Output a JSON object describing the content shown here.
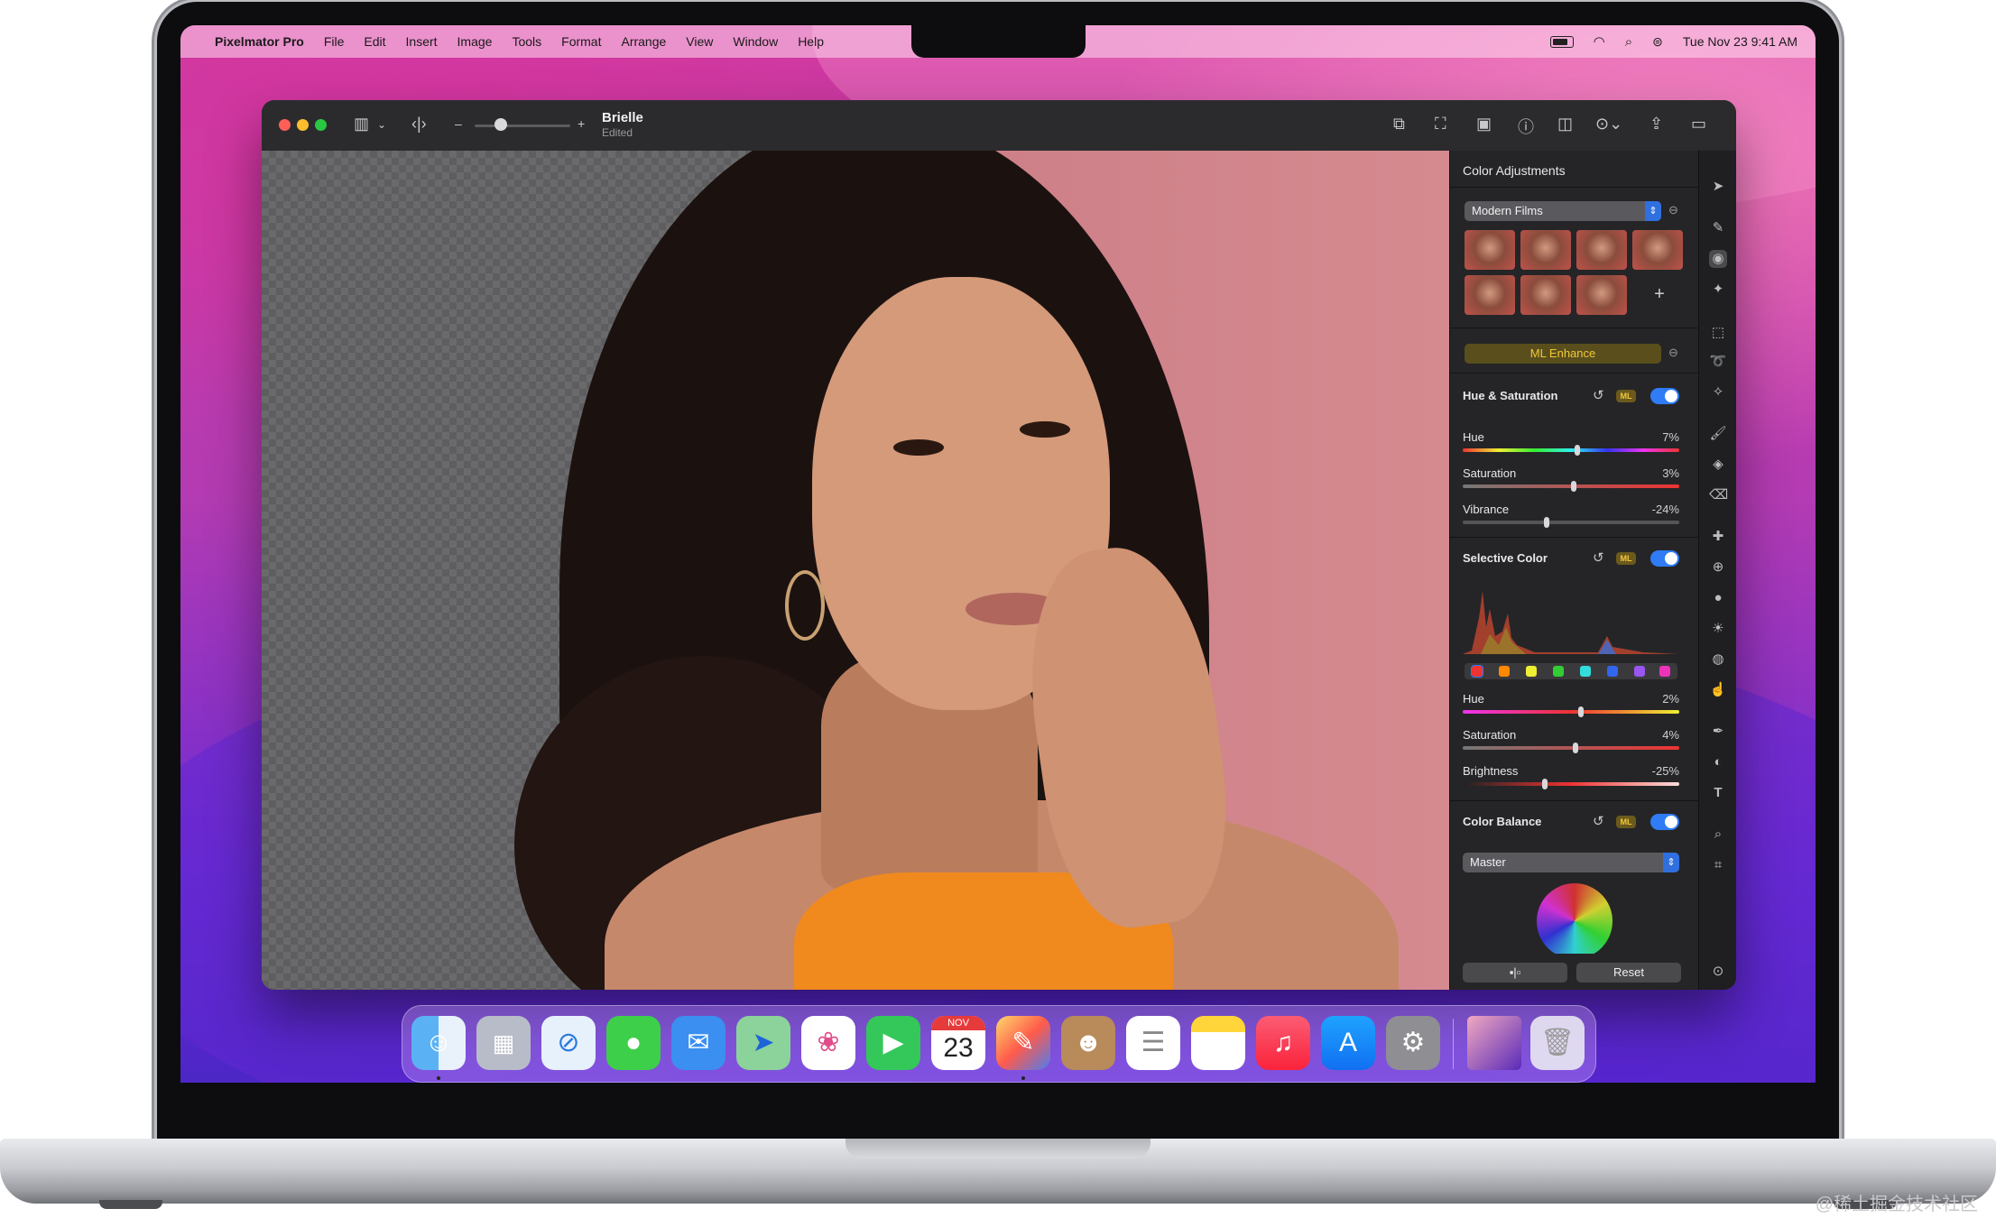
{
  "menubar": {
    "app_name": "Pixelmator Pro",
    "items": [
      "File",
      "Edit",
      "Insert",
      "Image",
      "Tools",
      "Format",
      "Arrange",
      "View",
      "Window",
      "Help"
    ],
    "clock": "Tue Nov 23  9:41 AM"
  },
  "window": {
    "doc_title": "Brielle",
    "doc_subtitle": "Edited",
    "zoom_minus": "–",
    "zoom_plus": "+"
  },
  "inspector": {
    "title": "Color Adjustments",
    "preset": "Modern Films",
    "add_preset": "+",
    "ml_enhance": "ML Enhance",
    "hue_sat": {
      "title": "Hue & Saturation",
      "ml": "ML",
      "rows": [
        {
          "label": "Hue",
          "value": "7%"
        },
        {
          "label": "Saturation",
          "value": "3%"
        },
        {
          "label": "Vibrance",
          "value": "-24%"
        }
      ]
    },
    "selective": {
      "title": "Selective Color",
      "ml": "ML",
      "rows": [
        {
          "label": "Hue",
          "value": "2%"
        },
        {
          "label": "Saturation",
          "value": "4%"
        },
        {
          "label": "Brightness",
          "value": "-25%"
        }
      ]
    },
    "balance": {
      "title": "Color Balance",
      "ml": "ML",
      "mode": "Master"
    },
    "reset": "Reset",
    "compare_label": "▪|▫"
  },
  "calendar": {
    "month": "NOV",
    "day": "23"
  },
  "watermark": "@稀土掘金技术社区",
  "colors": {
    "accent": "#2f7cf6",
    "ml_gold": "#f2c73a"
  }
}
